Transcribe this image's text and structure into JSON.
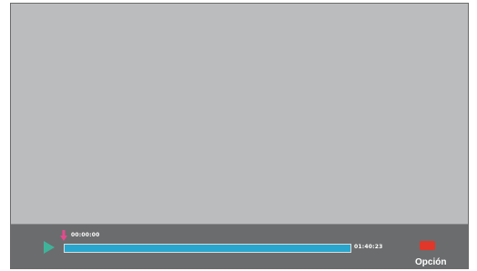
{
  "player": {
    "current_time": "00:00:00",
    "total_time": "01:40:23",
    "progress_fraction": 0.0,
    "buffered_fraction": 1.0,
    "state": "paused"
  },
  "controls": {
    "play_icon": "play-icon",
    "playhead_icon": "down-arrow-marker-icon",
    "option_key_icon": "red-key-icon",
    "option_label": "Opción"
  },
  "colors": {
    "video_area": "#bbbcbe",
    "control_bar": "#6b6c6e",
    "play_icon": "#3fb39a",
    "progress_fill": "#29a6cd",
    "playhead_marker": "#e64a8c",
    "red_key": "#e0372a",
    "text": "#ffffff"
  }
}
